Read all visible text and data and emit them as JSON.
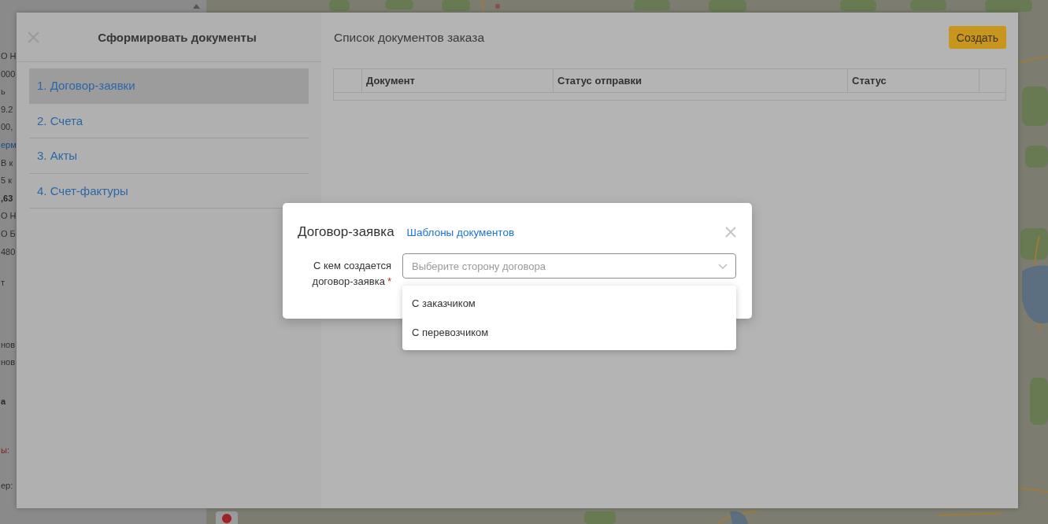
{
  "background_page": {
    "fragment_groups": [
      {
        "lines": [
          {
            "text": "О Н",
            "kind": "plain"
          },
          {
            "text": "000",
            "kind": "plain"
          },
          {
            "text": "ь",
            "kind": "plain"
          },
          {
            "text": "9.2",
            "kind": "plain"
          },
          {
            "text": "00,",
            "kind": "plain"
          },
          {
            "text": "ерм",
            "kind": "link"
          },
          {
            "text": "В к",
            "kind": "plain"
          },
          {
            "text": "5 к",
            "kind": "plain"
          },
          {
            "text": ",63",
            "kind": "bold"
          },
          {
            "text": "О Н",
            "kind": "plain"
          },
          {
            "text": "О Б",
            "kind": "plain"
          },
          {
            "text": "480",
            "kind": "plain"
          }
        ]
      },
      {
        "lines": [
          {
            "text": "т",
            "kind": "plain"
          }
        ]
      },
      {
        "lines": [
          {
            "text": "нов",
            "kind": "plain"
          },
          {
            "text": "нов",
            "kind": "plain"
          }
        ]
      },
      {
        "lines": [
          {
            "text": "а",
            "kind": "bold"
          }
        ]
      },
      {
        "lines": [
          {
            "text": "ы:",
            "kind": "error"
          }
        ]
      },
      {
        "lines": [
          {
            "text": "ер:",
            "kind": "plain"
          }
        ]
      }
    ]
  },
  "drawer": {
    "sidebar": {
      "title": "Сформировать документы",
      "items": [
        {
          "label": "1. Договор-заявки",
          "selected": true
        },
        {
          "label": "2. Счета",
          "selected": false
        },
        {
          "label": "3. Акты",
          "selected": false
        },
        {
          "label": "4. Счет-фактуры",
          "selected": false
        }
      ]
    },
    "main": {
      "title": "Список документов заказа",
      "create_button": "Создать",
      "table": {
        "columns": [
          "Документ",
          "Статус отправки",
          "Статус"
        ]
      }
    }
  },
  "modal": {
    "title": "Договор-заявка",
    "templates_link": "Шаблоны документов",
    "form": {
      "label": "С кем создается договор-заявка",
      "required_mark": "*",
      "select": {
        "placeholder": "Выберите сторону договора"
      },
      "dropdown": {
        "open": true,
        "options": [
          {
            "label": "С заказчиком",
            "selected": false
          },
          {
            "label": "С перевозчиком",
            "selected": false
          }
        ]
      }
    }
  }
}
